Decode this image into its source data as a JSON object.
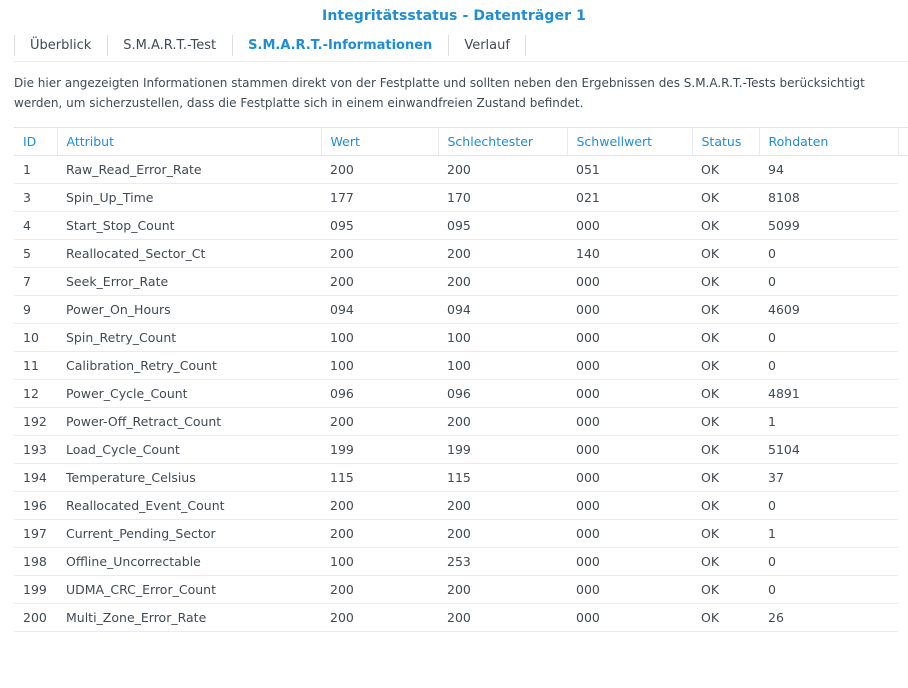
{
  "window": {
    "title": "Integritätsstatus - Datenträger 1"
  },
  "tabs": [
    {
      "label": "Überblick",
      "active": false
    },
    {
      "label": "S.M.A.R.T.-Test",
      "active": false
    },
    {
      "label": "S.M.A.R.T.-Informationen",
      "active": true
    },
    {
      "label": "Verlauf",
      "active": false
    }
  ],
  "description": "Die hier angezeigten Informationen stammen direkt von der Festplatte und sollten neben den Ergebnissen des S.M.A.R.T.-Tests berücksichtigt werden, um sicherzustellen, dass die Festplatte sich in einem einwandfreien Zustand befindet.",
  "colors": {
    "accent": "#1f8dd6",
    "text": "#404a54"
  },
  "table": {
    "columns": [
      "ID",
      "Attribut",
      "Wert",
      "Schlechtester",
      "Schwellwert",
      "Status",
      "Rohdaten"
    ],
    "rows": [
      [
        "1",
        "Raw_Read_Error_Rate",
        "200",
        "200",
        "051",
        "OK",
        "94"
      ],
      [
        "3",
        "Spin_Up_Time",
        "177",
        "170",
        "021",
        "OK",
        "8108"
      ],
      [
        "4",
        "Start_Stop_Count",
        "095",
        "095",
        "000",
        "OK",
        "5099"
      ],
      [
        "5",
        "Reallocated_Sector_Ct",
        "200",
        "200",
        "140",
        "OK",
        "0"
      ],
      [
        "7",
        "Seek_Error_Rate",
        "200",
        "200",
        "000",
        "OK",
        "0"
      ],
      [
        "9",
        "Power_On_Hours",
        "094",
        "094",
        "000",
        "OK",
        "4609"
      ],
      [
        "10",
        "Spin_Retry_Count",
        "100",
        "100",
        "000",
        "OK",
        "0"
      ],
      [
        "11",
        "Calibration_Retry_Count",
        "100",
        "100",
        "000",
        "OK",
        "0"
      ],
      [
        "12",
        "Power_Cycle_Count",
        "096",
        "096",
        "000",
        "OK",
        "4891"
      ],
      [
        "192",
        "Power-Off_Retract_Count",
        "200",
        "200",
        "000",
        "OK",
        "1"
      ],
      [
        "193",
        "Load_Cycle_Count",
        "199",
        "199",
        "000",
        "OK",
        "5104"
      ],
      [
        "194",
        "Temperature_Celsius",
        "115",
        "115",
        "000",
        "OK",
        "37"
      ],
      [
        "196",
        "Reallocated_Event_Count",
        "200",
        "200",
        "000",
        "OK",
        "0"
      ],
      [
        "197",
        "Current_Pending_Sector",
        "200",
        "200",
        "000",
        "OK",
        "1"
      ],
      [
        "198",
        "Offline_Uncorrectable",
        "100",
        "253",
        "000",
        "OK",
        "0"
      ],
      [
        "199",
        "UDMA_CRC_Error_Count",
        "200",
        "200",
        "000",
        "OK",
        "0"
      ],
      [
        "200",
        "Multi_Zone_Error_Rate",
        "200",
        "200",
        "000",
        "OK",
        "26"
      ]
    ]
  }
}
